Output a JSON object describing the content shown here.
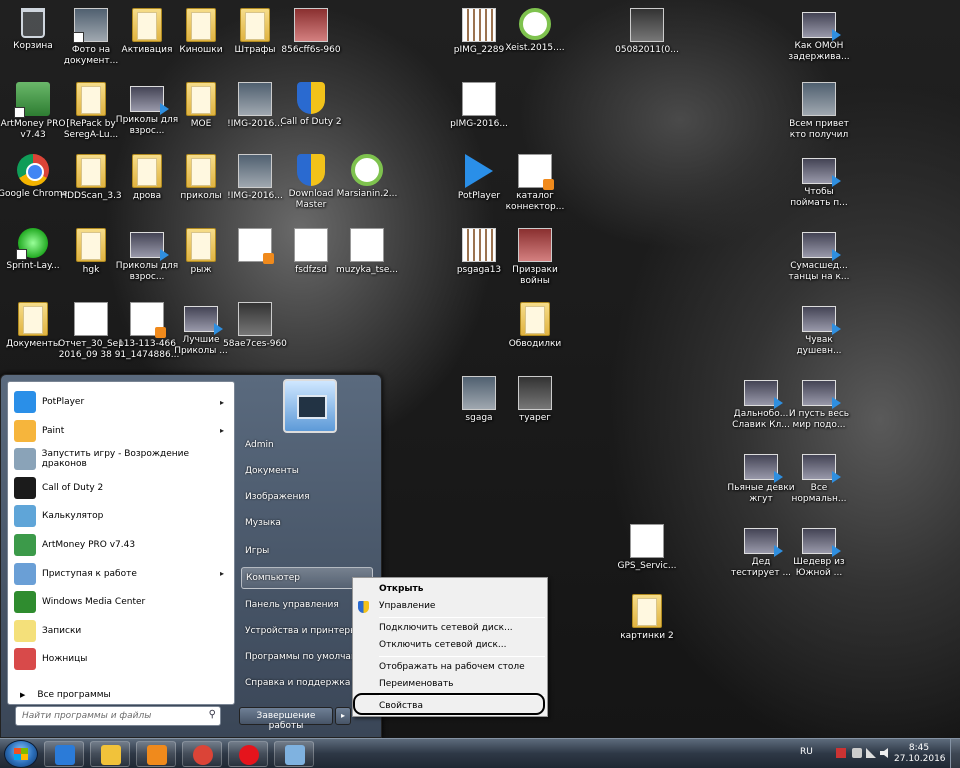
{
  "desktop_icons": [
    {
      "name": "icon-recycle-bin",
      "label": "Корзина",
      "x": 0,
      "y": 0
    },
    {
      "name": "icon-foto-na-dokument",
      "label": "Фото на документ...",
      "x": 1,
      "y": 0
    },
    {
      "name": "icon-aktivaciya",
      "label": "Активация",
      "x": 2,
      "y": 0
    },
    {
      "name": "icon-kinoshki",
      "label": "Киношки",
      "x": 3,
      "y": 0
    },
    {
      "name": "icon-shtrafy",
      "label": "Штрафы",
      "x": 4,
      "y": 0
    },
    {
      "name": "icon-856cff6s",
      "label": "856cff6s-960",
      "x": 5,
      "y": 0
    },
    {
      "name": "icon-pimg-2289",
      "label": "pIMG_2289",
      "x": 8,
      "y": 0
    },
    {
      "name": "icon-xeist",
      "label": "Xeist.2015....",
      "x": 9,
      "y": 0
    },
    {
      "name": "icon-05082011",
      "label": "05082011(0...",
      "x": 11,
      "y": 0
    },
    {
      "name": "icon-kak-omon",
      "label": "Как ОМОН задержива...",
      "x": 14,
      "y": 0
    },
    {
      "name": "icon-artmoney",
      "label": "ArtMoney PRO v7.43",
      "x": 0,
      "y": 1
    },
    {
      "name": "icon-repack",
      "label": "[RePack by SeregA-Lu...",
      "x": 1,
      "y": 1
    },
    {
      "name": "icon-prikoly-1",
      "label": "Приколы для взрос...",
      "x": 2,
      "y": 1
    },
    {
      "name": "icon-moe",
      "label": "МОЕ",
      "x": 3,
      "y": 1
    },
    {
      "name": "icon-img-2016-1",
      "label": "!IMG-2016...",
      "x": 4,
      "y": 1
    },
    {
      "name": "icon-call-of-duty-2",
      "label": "Call of Duty 2",
      "x": 5,
      "y": 1
    },
    {
      "name": "icon-pimg-2016",
      "label": "pIMG-2016...",
      "x": 8,
      "y": 1
    },
    {
      "name": "icon-vsem-privet",
      "label": "Всем привет кто получил",
      "x": 14,
      "y": 1
    },
    {
      "name": "icon-google-chrome",
      "label": "Google Chrome",
      "x": 0,
      "y": 2
    },
    {
      "name": "icon-hddscan",
      "label": "HDDScan_3.3",
      "x": 1,
      "y": 2
    },
    {
      "name": "icon-drova",
      "label": "дрова",
      "x": 2,
      "y": 2
    },
    {
      "name": "icon-prikoly-folder",
      "label": "приколы",
      "x": 3,
      "y": 2
    },
    {
      "name": "icon-img-2016-2",
      "label": "!IMG-2016...",
      "x": 4,
      "y": 2
    },
    {
      "name": "icon-download-master",
      "label": "Download Master",
      "x": 5,
      "y": 2
    },
    {
      "name": "icon-marsianin",
      "label": "Marsianin.2...",
      "x": 6,
      "y": 2
    },
    {
      "name": "icon-potplayer-desktop",
      "label": "PotPlayer",
      "x": 8,
      "y": 2
    },
    {
      "name": "icon-katalog",
      "label": "каталог коннектор...",
      "x": 9,
      "y": 2
    },
    {
      "name": "icon-chtoby-poimat",
      "label": "Чтобы поймать п...",
      "x": 14,
      "y": 2
    },
    {
      "name": "icon-sprint-layout",
      "label": "Sprint-Lay...",
      "x": 0,
      "y": 3
    },
    {
      "name": "icon-hgk",
      "label": "hgk",
      "x": 1,
      "y": 3
    },
    {
      "name": "icon-prikoly-2",
      "label": "Приколы для взрос...",
      "x": 2,
      "y": 3
    },
    {
      "name": "icon-ryzh",
      "label": "рыж",
      "x": 3,
      "y": 3
    },
    {
      "name": "icon-blank-doc",
      "label": "",
      "x": 4,
      "y": 3
    },
    {
      "name": "icon-fsdfzsd",
      "label": "fsdfzsd",
      "x": 5,
      "y": 3
    },
    {
      "name": "icon-muzyka",
      "label": "muzyka_tse...",
      "x": 6,
      "y": 3
    },
    {
      "name": "icon-psgaga13",
      "label": "psgaga13",
      "x": 8,
      "y": 3
    },
    {
      "name": "icon-prizraki",
      "label": "Призраки войны",
      "x": 9,
      "y": 3
    },
    {
      "name": "icon-sumasshed",
      "label": "Сумасшед... танцы на к...",
      "x": 14,
      "y": 3
    },
    {
      "name": "icon-dokumenty",
      "label": "Документы",
      "x": 0,
      "y": 4
    },
    {
      "name": "icon-otchet",
      "label": "Отчет_30_Sep 2016_09 38 ...",
      "x": 1,
      "y": 4
    },
    {
      "name": "icon-113-113",
      "label": "113-113-466 91_1474886...",
      "x": 2,
      "y": 4
    },
    {
      "name": "icon-luchshie-prikoly",
      "label": "Лучшие Приколы ...",
      "x": 3,
      "y": 4
    },
    {
      "name": "icon-58ae7ces",
      "label": "58ae7ces-960",
      "x": 4,
      "y": 4
    },
    {
      "name": "icon-obvodilki",
      "label": "Обводилки",
      "x": 9,
      "y": 4
    },
    {
      "name": "icon-chuvak",
      "label": "Чувак душевн...",
      "x": 14,
      "y": 4
    },
    {
      "name": "icon-sgaga",
      "label": "sgaga",
      "x": 8,
      "y": 5
    },
    {
      "name": "icon-tuareg",
      "label": "туарег",
      "x": 9,
      "y": 5
    },
    {
      "name": "icon-dalnobo",
      "label": "Дальнобо... Славик Кл...",
      "x": 13,
      "y": 5
    },
    {
      "name": "icon-i-pust-ves",
      "label": "И пусть весь мир подо...",
      "x": 14,
      "y": 5
    },
    {
      "name": "icon-pyanye",
      "label": "Пьяные девки жгут",
      "x": 13,
      "y": 6
    },
    {
      "name": "icon-vse-normalnye",
      "label": "Все нормальн...",
      "x": 14,
      "y": 6
    },
    {
      "name": "icon-gps-service",
      "label": "GPS_Servic...",
      "x": 11,
      "y": 7
    },
    {
      "name": "icon-ded-testiruet",
      "label": "Дед тестирует ...",
      "x": 13,
      "y": 7
    },
    {
      "name": "icon-shedevr",
      "label": "Шедевр из Южной ...",
      "x": 14,
      "y": 7
    },
    {
      "name": "icon-kartinki-2",
      "label": "картинки 2",
      "x": 11,
      "y": 8
    }
  ],
  "start_menu": {
    "programs": [
      {
        "name": "sm-item-potplayer",
        "label": "PotPlayer",
        "arrow": "▸"
      },
      {
        "name": "sm-item-paint",
        "label": "Paint",
        "arrow": "▸"
      },
      {
        "name": "sm-item-vozrozhdenie",
        "label": "Запустить игру - Возрождение драконов",
        "arrow": ""
      },
      {
        "name": "sm-item-call-of-duty",
        "label": "Call of Duty 2",
        "arrow": ""
      },
      {
        "name": "sm-item-calculator",
        "label": "Калькулятор",
        "arrow": ""
      },
      {
        "name": "sm-item-artmoney",
        "label": "ArtMoney PRO v7.43",
        "arrow": ""
      },
      {
        "name": "sm-item-getting-started",
        "label": "Приступая к работе",
        "arrow": "▸"
      },
      {
        "name": "sm-item-media-center",
        "label": "Windows Media Center",
        "arrow": ""
      },
      {
        "name": "sm-item-sticky-notes",
        "label": "Записки",
        "arrow": ""
      },
      {
        "name": "sm-item-snipping",
        "label": "Ножницы",
        "arrow": ""
      }
    ],
    "all_programs": "Все программы",
    "all_programs_arrow": "▶",
    "search_placeholder": "Найти программы и файлы",
    "search_icon": "⚲",
    "right_items": [
      {
        "name": "sm-right-admin",
        "label": "Admin"
      },
      {
        "name": "sm-right-documents",
        "label": "Документы"
      },
      {
        "name": "sm-right-pictures",
        "label": "Изображения"
      },
      {
        "name": "sm-right-music",
        "label": "Музыка"
      },
      {
        "name": "sm-right-games",
        "label": "Игры"
      },
      {
        "name": "sm-right-computer",
        "label": "Компьютер"
      },
      {
        "name": "sm-right-control-panel",
        "label": "Панель управления"
      },
      {
        "name": "sm-right-devices",
        "label": "Устройства и принтеры"
      },
      {
        "name": "sm-right-default-programs",
        "label": "Программы по умолчанию"
      },
      {
        "name": "sm-right-help",
        "label": "Справка и поддержка"
      }
    ],
    "shutdown_label": "Завершение работы",
    "shutdown_arrow": "▸"
  },
  "context_menu": {
    "items": [
      {
        "name": "ctx-open",
        "label": "Открыть",
        "bold": true
      },
      {
        "name": "ctx-manage",
        "label": "Управление",
        "bold": false
      },
      {
        "name": "ctx-map-drive",
        "label": "Подключить сетевой диск...",
        "bold": false
      },
      {
        "name": "ctx-disconnect-drive",
        "label": "Отключить сетевой диск...",
        "bold": false
      },
      {
        "name": "ctx-show-on-desktop",
        "label": "Отображать на рабочем столе",
        "bold": false
      },
      {
        "name": "ctx-rename",
        "label": "Переименовать",
        "bold": false
      },
      {
        "name": "ctx-properties",
        "label": "Свойства",
        "bold": false
      }
    ]
  },
  "taskbar": {
    "pinned": [
      {
        "name": "taskbar-ie",
        "color": "#2b7bd8"
      },
      {
        "name": "taskbar-explorer",
        "color": "#f1c23a"
      },
      {
        "name": "taskbar-media-player",
        "color": "#f08a1c"
      },
      {
        "name": "taskbar-chrome",
        "color": "#db4437"
      },
      {
        "name": "taskbar-opera",
        "color": "#e5141c"
      },
      {
        "name": "taskbar-paint",
        "color": "#7fb2e0"
      }
    ],
    "language": "RU",
    "time": "8:45",
    "date": "27.10.2016"
  }
}
